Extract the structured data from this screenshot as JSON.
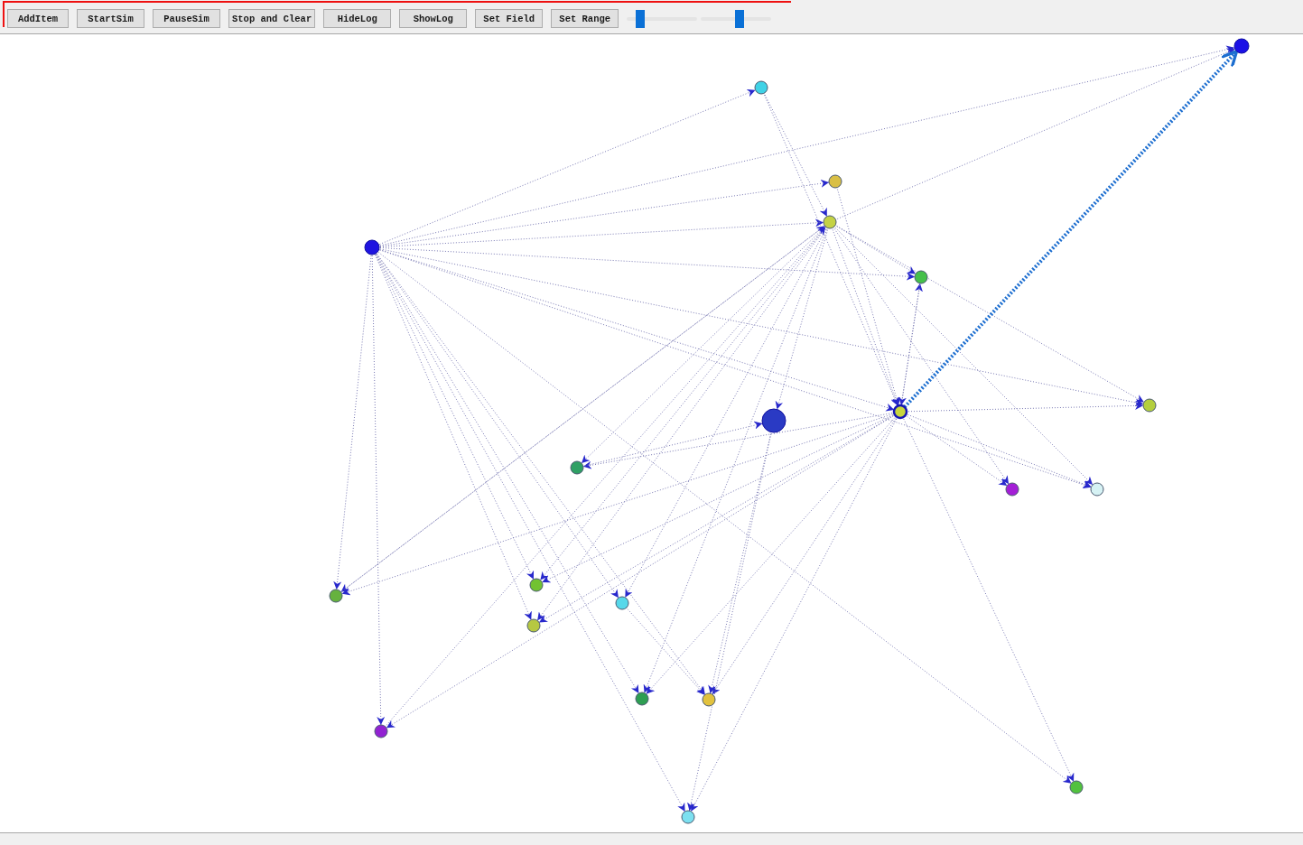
{
  "toolbar": {
    "highlighted": true,
    "buttons": [
      "AddItem",
      "StartSim",
      "PauseSim",
      "Stop and Clear",
      "HideLog",
      "ShowLog",
      "Set Field",
      "Set Range"
    ],
    "sliders": [
      {
        "level": 0.15
      },
      {
        "level": 0.55
      }
    ]
  },
  "graph": {
    "nodes": [
      {
        "kind": "hub",
        "color": "#1a10e6",
        "selected": false
      },
      {
        "kind": "node",
        "color": "#3fd2e6",
        "selected": false
      },
      {
        "kind": "node",
        "color": "#d9bf45",
        "selected": false
      },
      {
        "kind": "node",
        "color": "#c4d244",
        "selected": false
      },
      {
        "kind": "hub",
        "color": "#1f14e0",
        "selected": false
      },
      {
        "kind": "node",
        "color": "#45c04a",
        "selected": false
      },
      {
        "kind": "node",
        "color": "#b4cf3e",
        "selected": false
      },
      {
        "kind": "large",
        "color": "#2a3ac4",
        "selected": false
      },
      {
        "kind": "node",
        "color": "#c8d63c",
        "selected": true
      },
      {
        "kind": "node",
        "color": "#2fa064",
        "selected": false
      },
      {
        "kind": "node",
        "color": "#a41ed6",
        "selected": false
      },
      {
        "kind": "node",
        "color": "#d6f2f4",
        "selected": false
      },
      {
        "kind": "node",
        "color": "#66b23e",
        "selected": false
      },
      {
        "kind": "node",
        "color": "#72c232",
        "selected": false
      },
      {
        "kind": "node",
        "color": "#56d8ea",
        "selected": false
      },
      {
        "kind": "node",
        "color": "#b6c842",
        "selected": false
      },
      {
        "kind": "node",
        "color": "#2e9e52",
        "selected": false
      },
      {
        "kind": "node",
        "color": "#e2c23e",
        "selected": false
      },
      {
        "kind": "node",
        "color": "#9222d2",
        "selected": false
      },
      {
        "kind": "node",
        "color": "#7ce0f0",
        "selected": false
      },
      {
        "kind": "node",
        "color": "#52c23e",
        "selected": false
      }
    ]
  }
}
